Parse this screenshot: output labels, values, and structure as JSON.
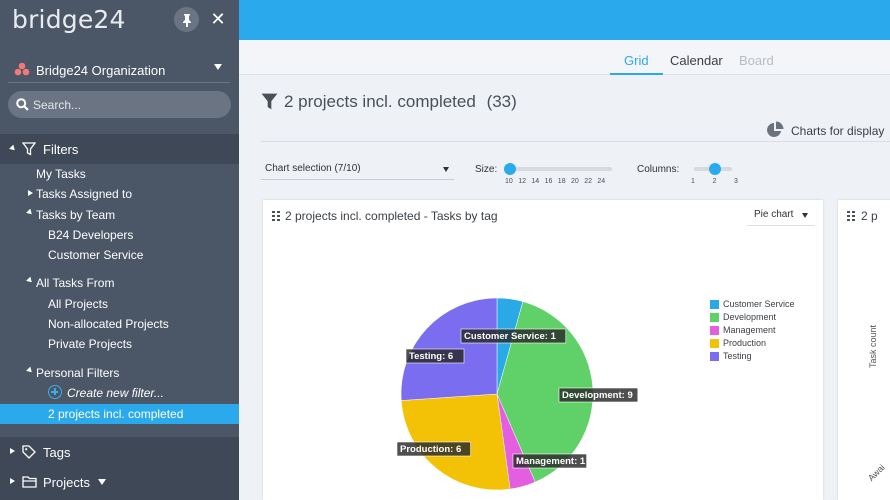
{
  "app": {
    "logo_text": "bridge24",
    "organization": "Bridge24 Organization",
    "search_placeholder": "Search..."
  },
  "sidebar": {
    "filters_label": "Filters",
    "items": [
      {
        "label": "My Tasks"
      },
      {
        "label": "Tasks Assigned to"
      },
      {
        "label": "Tasks by Team"
      },
      {
        "label": "B24 Developers"
      },
      {
        "label": "Customer Service"
      },
      {
        "label": "All Tasks From"
      },
      {
        "label": "All Projects"
      },
      {
        "label": "Non-allocated Projects"
      },
      {
        "label": "Private Projects"
      },
      {
        "label": "Personal Filters"
      },
      {
        "label": "Create new filter..."
      },
      {
        "label": "2 projects incl. completed"
      }
    ],
    "tags_label": "Tags",
    "projects_label": "Projects"
  },
  "view_tabs": [
    "Grid",
    "Calendar",
    "Board"
  ],
  "page": {
    "title": "2 projects incl. completed",
    "count": "(33)",
    "charts_for_display": "Charts for display"
  },
  "controls": {
    "chart_selection": "Chart selection (7/10)",
    "size_label": "Size:",
    "size_ticks": [
      "10",
      "12",
      "14",
      "16",
      "18",
      "20",
      "22",
      "24"
    ],
    "columns_label": "Columns:",
    "column_ticks": [
      "1",
      "2",
      "3"
    ],
    "size_value": 10,
    "columns_value": 2
  },
  "card": {
    "title": "2 projects incl. completed - Tasks by tag",
    "chart_type": "Pie chart"
  },
  "card2": {
    "title": "2 p",
    "ylabel": "Task count",
    "xlabel": "Awai"
  },
  "chart_data": {
    "type": "pie",
    "title": "",
    "categories": [
      "Customer Service",
      "Development",
      "Management",
      "Production",
      "Testing"
    ],
    "values": [
      1,
      9,
      1,
      6,
      6
    ],
    "colors": [
      "#29a9e5",
      "#5fd168",
      "#e35fe0",
      "#f3c105",
      "#7a6df0"
    ],
    "data_labels": [
      "Customer Service: 1",
      "Development: 9",
      "Management: 1",
      "Production: 6",
      "Testing: 6"
    ],
    "legend": "right"
  }
}
